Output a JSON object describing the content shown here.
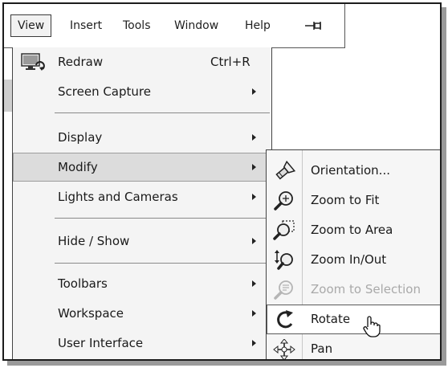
{
  "menubar": {
    "items": [
      {
        "label": "View",
        "active": true
      },
      {
        "label": "Insert"
      },
      {
        "label": "Tools"
      },
      {
        "label": "Window"
      },
      {
        "label": "Help"
      }
    ],
    "pin_icon": "pin-icon"
  },
  "view_menu": {
    "items": [
      {
        "label": "Redraw",
        "shortcut": "Ctrl+R",
        "icon": "redraw-icon"
      },
      {
        "label": "Screen Capture",
        "submenu": true
      },
      {
        "label": "Display",
        "submenu": true
      },
      {
        "label": "Modify",
        "submenu": true,
        "selected": true
      },
      {
        "label": "Lights and Cameras",
        "submenu": true
      },
      {
        "label": "Hide / Show",
        "submenu": true
      },
      {
        "label": "Toolbars",
        "submenu": true
      },
      {
        "label": "Workspace",
        "submenu": true
      },
      {
        "label": "User Interface",
        "submenu": true
      }
    ]
  },
  "modify_submenu": {
    "items": [
      {
        "label": "Orientation...",
        "icon": "flashlight-icon"
      },
      {
        "label": "Zoom to Fit",
        "icon": "zoom-fit-icon"
      },
      {
        "label": "Zoom to Area",
        "icon": "zoom-area-icon"
      },
      {
        "label": "Zoom In/Out",
        "icon": "zoom-in-out-icon"
      },
      {
        "label": "Zoom to Selection",
        "icon": "zoom-selection-icon",
        "disabled": true
      },
      {
        "label": "Rotate",
        "icon": "rotate-icon",
        "selected": true
      },
      {
        "label": "Pan",
        "icon": "pan-icon"
      }
    ]
  },
  "colors": {
    "menu_bg": "#f4f4f4",
    "selected_bg": "#dcdcdc",
    "disabled_text": "#a9a9a9",
    "frame": "#1c1c1c"
  }
}
